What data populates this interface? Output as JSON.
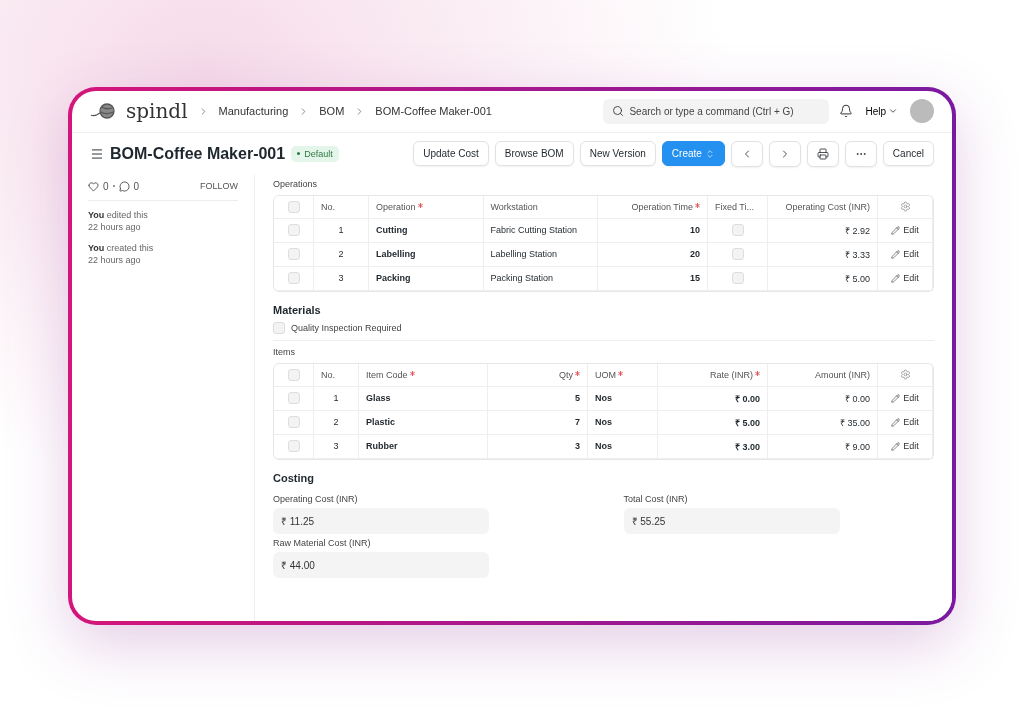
{
  "topbar": {
    "logo": "spindl",
    "breadcrumbs": [
      "Manufacturing",
      "BOM",
      "BOM-Coffee Maker-001"
    ],
    "search": {
      "placeholder": "Search or type a command (Ctrl + G)"
    },
    "help": "Help"
  },
  "header": {
    "title": "BOM-Coffee Maker-001",
    "badge": "Default",
    "actions": [
      {
        "kind": "default",
        "label": "Update Cost"
      },
      {
        "kind": "default",
        "label": "Browse BOM"
      },
      {
        "kind": "default",
        "label": "New Version"
      },
      {
        "kind": "primary",
        "label": "Create"
      }
    ],
    "cancel": "Cancel"
  },
  "sidebar": {
    "likes": "0",
    "comments": "0",
    "follow": "FOLLOW",
    "activity": [
      {
        "text": "**You** edited this",
        "time": "22 hours ago"
      },
      {
        "text": "**You** created this",
        "time": "22 hours ago"
      }
    ]
  },
  "operations": {
    "label": "Operations",
    "select_all": {
      "checked": false
    },
    "columns": [
      {
        "label": "No.",
        "required": false
      },
      {
        "label": "Operation",
        "required": true
      },
      {
        "label": "Workstation",
        "required": false
      },
      {
        "label": "Operation Time",
        "required": true
      },
      {
        "label": "Fixed Ti...",
        "required": false
      },
      {
        "label": "Operating Cost (INR)",
        "required": false
      }
    ],
    "rows": [
      {
        "checked": false,
        "no": "1",
        "operation": "Cutting",
        "workstation": "Fabric Cutting Station",
        "time": "10",
        "fixed_time": false,
        "cost": "₹ 2.92",
        "edit": "Edit"
      },
      {
        "checked": false,
        "no": "2",
        "operation": "Labelling",
        "workstation": "Labelling Station",
        "time": "20",
        "fixed_time": false,
        "cost": "₹ 3.33",
        "edit": "Edit"
      },
      {
        "checked": false,
        "no": "3",
        "operation": "Packing",
        "workstation": "Packing Station",
        "time": "15",
        "fixed_time": false,
        "cost": "₹ 5.00",
        "edit": "Edit"
      }
    ]
  },
  "materials": {
    "title": "Materials",
    "quality_inspection": {
      "label": "Quality Inspection Required",
      "checked": false
    },
    "items_label": "Items",
    "select_all": {
      "checked": false
    },
    "columns": [
      {
        "label": "No.",
        "required": false
      },
      {
        "label": "Item Code",
        "required": true
      },
      {
        "label": "Qty",
        "required": true
      },
      {
        "label": "UOM",
        "required": true
      },
      {
        "label": "Rate (INR)",
        "required": true
      },
      {
        "label": "Amount (INR)",
        "required": false
      }
    ],
    "rows": [
      {
        "checked": false,
        "no": "1",
        "item": "Glass",
        "qty": "5",
        "uom": "Nos",
        "rate": "₹ 0.00",
        "amount": "₹ 0.00",
        "edit": "Edit"
      },
      {
        "checked": false,
        "no": "2",
        "item": "Plastic",
        "qty": "7",
        "uom": "Nos",
        "rate": "₹ 5.00",
        "amount": "₹ 35.00",
        "edit": "Edit"
      },
      {
        "checked": false,
        "no": "3",
        "item": "Rubber",
        "qty": "3",
        "uom": "Nos",
        "rate": "₹ 3.00",
        "amount": "₹ 9.00",
        "edit": "Edit"
      }
    ]
  },
  "costing": {
    "title": "Costing",
    "left": [
      {
        "label": "Operating Cost (INR)",
        "value": "₹ 11.25"
      },
      {
        "label": "Raw Material Cost (INR)",
        "value": "₹ 44.00"
      }
    ],
    "right": [
      {
        "label": "Total Cost (INR)",
        "value": "₹ 55.25"
      }
    ]
  }
}
